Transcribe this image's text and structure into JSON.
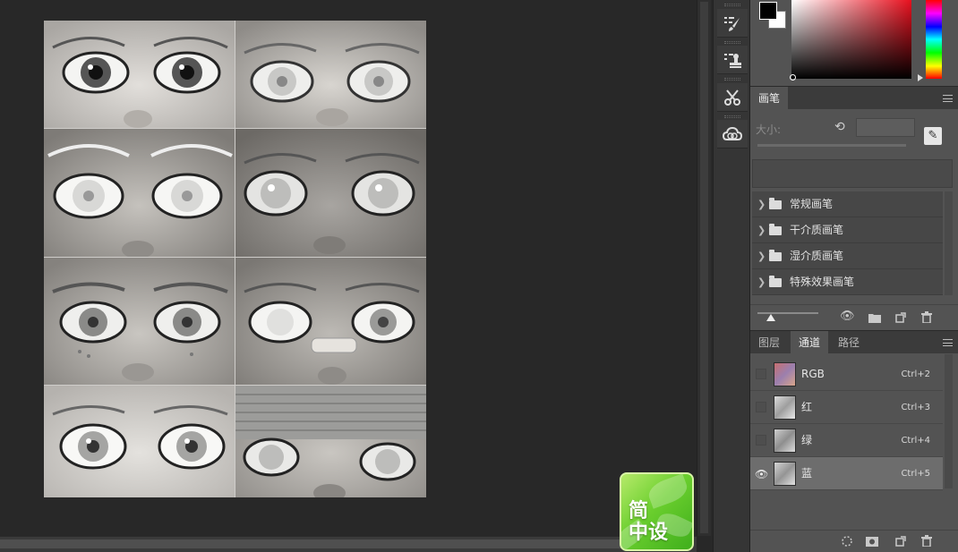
{
  "brush_panel": {
    "tab_label": "画笔",
    "size_label": "大小:",
    "groups": [
      {
        "label": "常规画笔"
      },
      {
        "label": "干介质画笔"
      },
      {
        "label": "湿介质画笔"
      },
      {
        "label": "特殊效果画笔"
      }
    ]
  },
  "layers_panel": {
    "tabs": [
      {
        "label": "图层",
        "active": false
      },
      {
        "label": "通道",
        "active": true
      },
      {
        "label": "路径",
        "active": false
      }
    ],
    "channels": [
      {
        "name": "RGB",
        "shortcut": "Ctrl+2",
        "visible": false,
        "selected": false
      },
      {
        "name": "红",
        "shortcut": "Ctrl+3",
        "visible": false,
        "selected": false
      },
      {
        "name": "绿",
        "shortcut": "Ctrl+4",
        "visible": false,
        "selected": false
      },
      {
        "name": "蓝",
        "shortcut": "Ctrl+5",
        "visible": true,
        "selected": true
      }
    ]
  },
  "watermark": {
    "line1": "简",
    "line2": "中设"
  },
  "colors": {
    "foreground": "#000000",
    "background": "#ffffff",
    "hue": "#e8101e",
    "panel": "#535353",
    "workspace": "#282828"
  },
  "icons": {
    "tools": [
      "brush-settings-icon",
      "clone-source-icon",
      "tool-presets-icon",
      "creative-cloud-libraries-icon"
    ],
    "brush_footer": [
      "visibility-toggle-icon",
      "new-group-icon",
      "new-brush-icon",
      "delete-icon"
    ],
    "channels_footer": [
      "load-selection-icon",
      "save-selection-icon",
      "new-channel-icon",
      "delete-channel-icon"
    ]
  }
}
